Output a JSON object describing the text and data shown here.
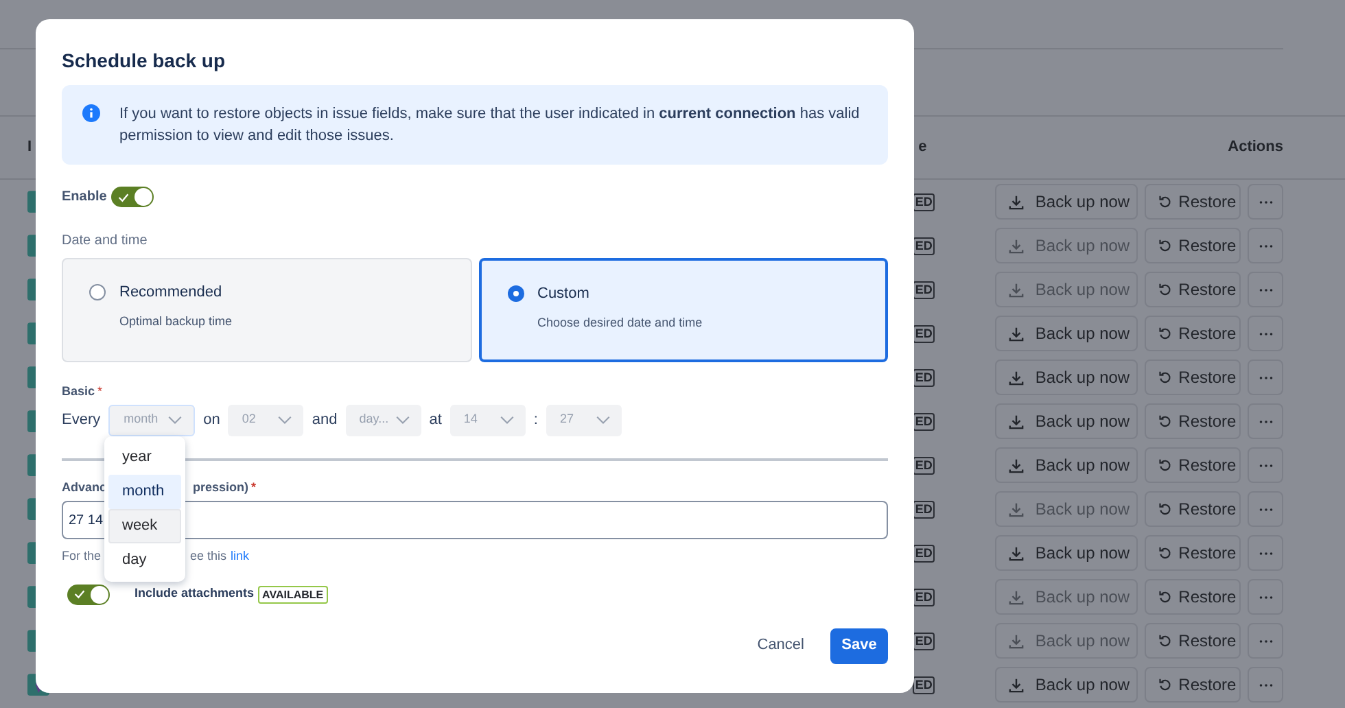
{
  "background_table": {
    "columns": [
      {
        "label": "I"
      },
      {
        "label": "e"
      },
      {
        "label": "Actions"
      }
    ],
    "rows": [
      {
        "status": "ED",
        "backup": "Back up now",
        "backup_disabled": false,
        "restore": "Restore"
      },
      {
        "status": "ED",
        "backup": "Back up now",
        "backup_disabled": true,
        "restore": "Restore"
      },
      {
        "status": "ED",
        "backup": "Back up now",
        "backup_disabled": true,
        "restore": "Restore"
      },
      {
        "status": "ED",
        "backup": "Back up now",
        "backup_disabled": false,
        "restore": "Restore"
      },
      {
        "status": "ED",
        "backup": "Back up now",
        "backup_disabled": false,
        "restore": "Restore"
      },
      {
        "status": "ED",
        "backup": "Back up now",
        "backup_disabled": false,
        "restore": "Restore"
      },
      {
        "status": "ED",
        "backup": "Back up now",
        "backup_disabled": false,
        "restore": "Restore"
      },
      {
        "status": "ED",
        "backup": "Back up now",
        "backup_disabled": true,
        "restore": "Restore"
      },
      {
        "status": "ED",
        "backup": "Back up now",
        "backup_disabled": false,
        "restore": "Restore"
      },
      {
        "status": "ED",
        "backup": "Back up now",
        "backup_disabled": true,
        "restore": "Restore"
      },
      {
        "status": "ED",
        "backup": "Back up now",
        "backup_disabled": true,
        "restore": "Restore"
      },
      {
        "status": "ED",
        "backup": "Back up now",
        "backup_disabled": false,
        "restore": "Restore"
      }
    ]
  },
  "dialog": {
    "title": "Schedule back up",
    "info": "If you want to restore objects in issue fields, make sure that the user indicated in **current connection** has valid permission to view and edit those issues.",
    "enable": {
      "label": "Enable",
      "on": true
    },
    "date_time": {
      "label": "Date and time",
      "options": [
        {
          "title": "Recommended",
          "subtitle": "Optimal backup time",
          "selected": false
        },
        {
          "title": "Custom",
          "subtitle": "Choose desired date and time",
          "selected": true
        }
      ]
    },
    "basic": {
      "label": "Basic",
      "required_mark": "*",
      "parts": [
        {
          "kind": "text",
          "text": "Every"
        },
        {
          "kind": "select",
          "value": "month",
          "focused": true
        },
        {
          "kind": "text",
          "text": "on"
        },
        {
          "kind": "select",
          "value": "02",
          "focused": false
        },
        {
          "kind": "text",
          "text": "and"
        },
        {
          "kind": "select",
          "value": "day...",
          "focused": false
        },
        {
          "kind": "text",
          "text": "at"
        },
        {
          "kind": "select",
          "value": "14",
          "focused": false
        },
        {
          "kind": "text",
          "text": ":"
        },
        {
          "kind": "select",
          "value": "27",
          "focused": false
        }
      ]
    },
    "advanced": {
      "label_start": "Advanc",
      "label_end": "pression)",
      "required_mark": "*",
      "value": "27 14",
      "help_start": "For the",
      "help_end": "ee this",
      "help_link": "link"
    },
    "attachments": {
      "on": true,
      "label": "Include attachments",
      "badge": "AVAILABLE"
    },
    "buttons": {
      "cancel": "Cancel",
      "save": "Save"
    },
    "dropdown": [
      {
        "label": "year",
        "selected": false,
        "hovered": false
      },
      {
        "label": "month",
        "selected": true,
        "hovered": false
      },
      {
        "label": "week",
        "selected": false,
        "hovered": true
      },
      {
        "label": "day",
        "selected": false,
        "hovered": false
      }
    ]
  }
}
